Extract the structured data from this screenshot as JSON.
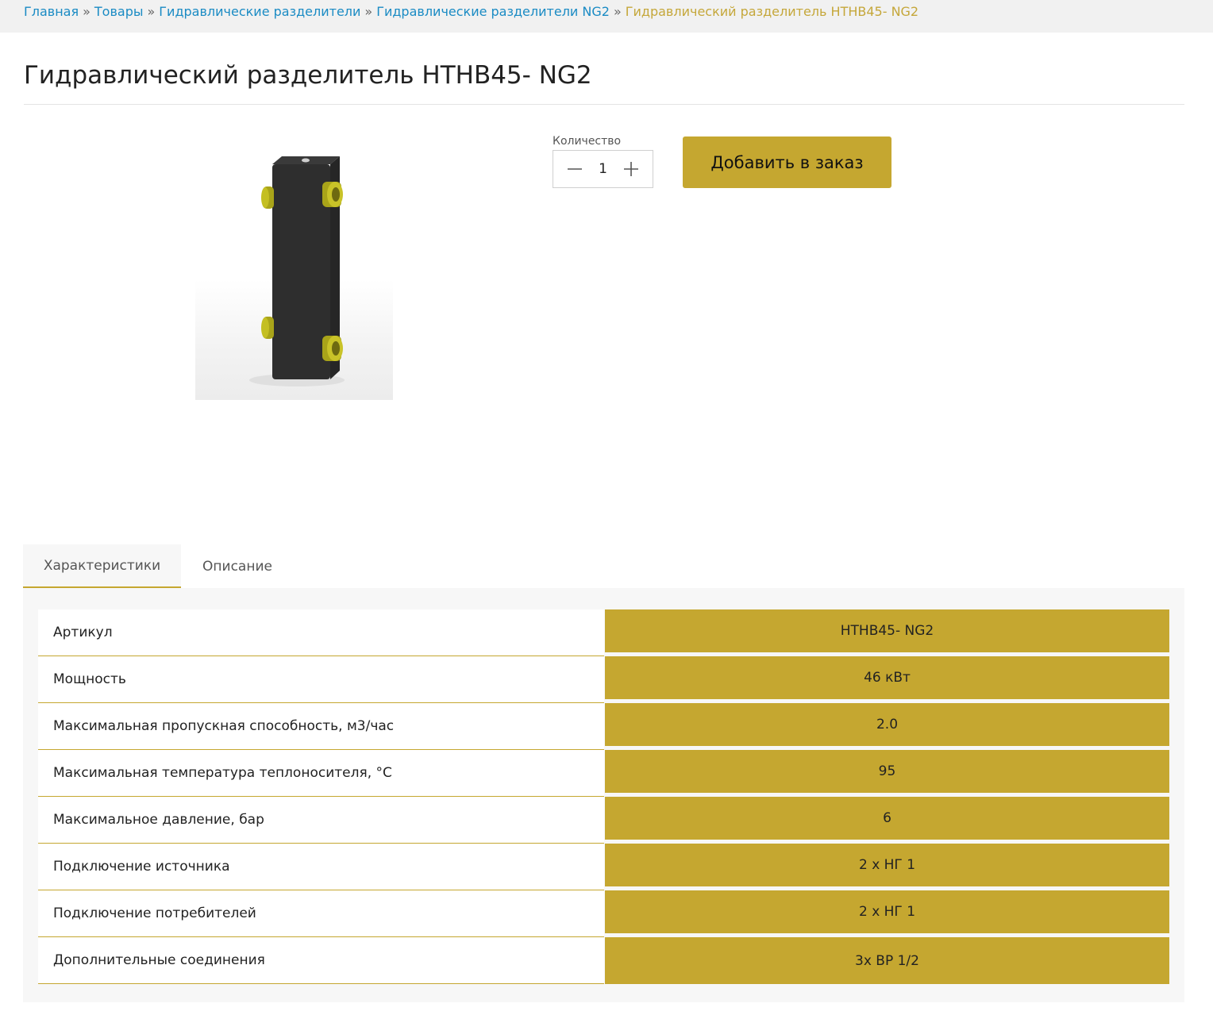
{
  "breadcrumb": {
    "items": [
      "Главная",
      "Товары",
      "Гидравлические разделители",
      "Гидравлические разделители NG2"
    ],
    "separator": "»",
    "current": "Гидравлический разделитель HTHB45- NG2"
  },
  "page_title": "Гидравлический разделитель HTHB45- NG2",
  "product_image": {
    "icon": "hydraulic-separator-image"
  },
  "order": {
    "quantity_label": "Количество",
    "quantity_value": "1",
    "add_button_label": "Добавить в заказ"
  },
  "tabs": [
    {
      "label": "Характеристики",
      "active": true
    },
    {
      "label": "Описание",
      "active": false
    }
  ],
  "specs": [
    {
      "name": "Артикул",
      "value": "HTHB45- NG2"
    },
    {
      "name": "Мощность",
      "value": "46 кВт"
    },
    {
      "name": "Максимальная пропускная способность, м3/час",
      "value": "2.0"
    },
    {
      "name": "Максимальная температура теплоносителя, °С",
      "value": "95"
    },
    {
      "name": "Максимальное давление, бар",
      "value": "6"
    },
    {
      "name": "Подключение источника",
      "value": "2 х НГ 1"
    },
    {
      "name": "Подключение потребителей",
      "value": "2 х НГ 1"
    },
    {
      "name": "Дополнительные соединения",
      "value": "3х ВР 1/2"
    }
  ],
  "colors": {
    "accent": "#c5a730",
    "link": "#1a8bc4",
    "breadcrumb_current": "#c5a73a",
    "breadcrumb_bg": "#f1f1f1"
  }
}
